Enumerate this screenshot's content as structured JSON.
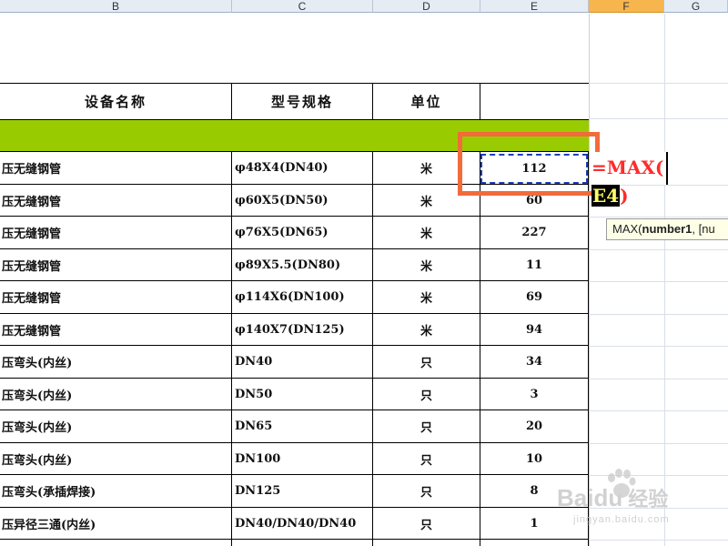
{
  "columns": [
    {
      "letter": "B"
    },
    {
      "letter": "C"
    },
    {
      "letter": "D"
    },
    {
      "letter": "E"
    },
    {
      "letter": "F"
    },
    {
      "letter": "G"
    }
  ],
  "table": {
    "headers": {
      "name": "设备名称",
      "spec": "型号规格",
      "unit": "单位"
    },
    "rows": [
      {
        "name": "压无缝钢管",
        "spec": "φ48X4(DN40)",
        "unit": "米",
        "qty": "112"
      },
      {
        "name": "压无缝钢管",
        "spec": "φ60X5(DN50)",
        "unit": "米",
        "qty": "60"
      },
      {
        "name": "压无缝钢管",
        "spec": "φ76X5(DN65)",
        "unit": "米",
        "qty": "227"
      },
      {
        "name": "压无缝钢管",
        "spec": "φ89X5.5(DN80)",
        "unit": "米",
        "qty": "11"
      },
      {
        "name": "压无缝钢管",
        "spec": "φ114X6(DN100)",
        "unit": "米",
        "qty": "69"
      },
      {
        "name": "压无缝钢管",
        "spec": "φ140X7(DN125)",
        "unit": "米",
        "qty": "94"
      },
      {
        "name": "压弯头(内丝)",
        "spec": "DN40",
        "unit": "只",
        "qty": "34"
      },
      {
        "name": "压弯头(内丝)",
        "spec": "DN50",
        "unit": "只",
        "qty": "3"
      },
      {
        "name": "压弯头(内丝)",
        "spec": "DN65",
        "unit": "只",
        "qty": "20"
      },
      {
        "name": "压弯头(内丝)",
        "spec": "DN100",
        "unit": "只",
        "qty": "10"
      },
      {
        "name": "压弯头(承插焊接)",
        "spec": "DN125",
        "unit": "只",
        "qty": "8"
      },
      {
        "name": "压异径三通(内丝)",
        "spec": "DN40/DN40/DN40",
        "unit": "只",
        "qty": "1"
      }
    ]
  },
  "formula": {
    "line1": "=MAX(",
    "ref": "E4",
    "close": ")"
  },
  "tooltip": {
    "fn": "MAX(",
    "arg": "number1",
    "rest": ", [nu"
  },
  "watermark": {
    "brand": "Bai",
    "paw": "du",
    "cn": "经验",
    "url": "jingyan.baidu.com"
  },
  "colors": {
    "green_band": "#99cc00",
    "highlight_box": "#f26b3a",
    "formula_text": "#ff2b2b",
    "selection": "#1d3fb5"
  }
}
